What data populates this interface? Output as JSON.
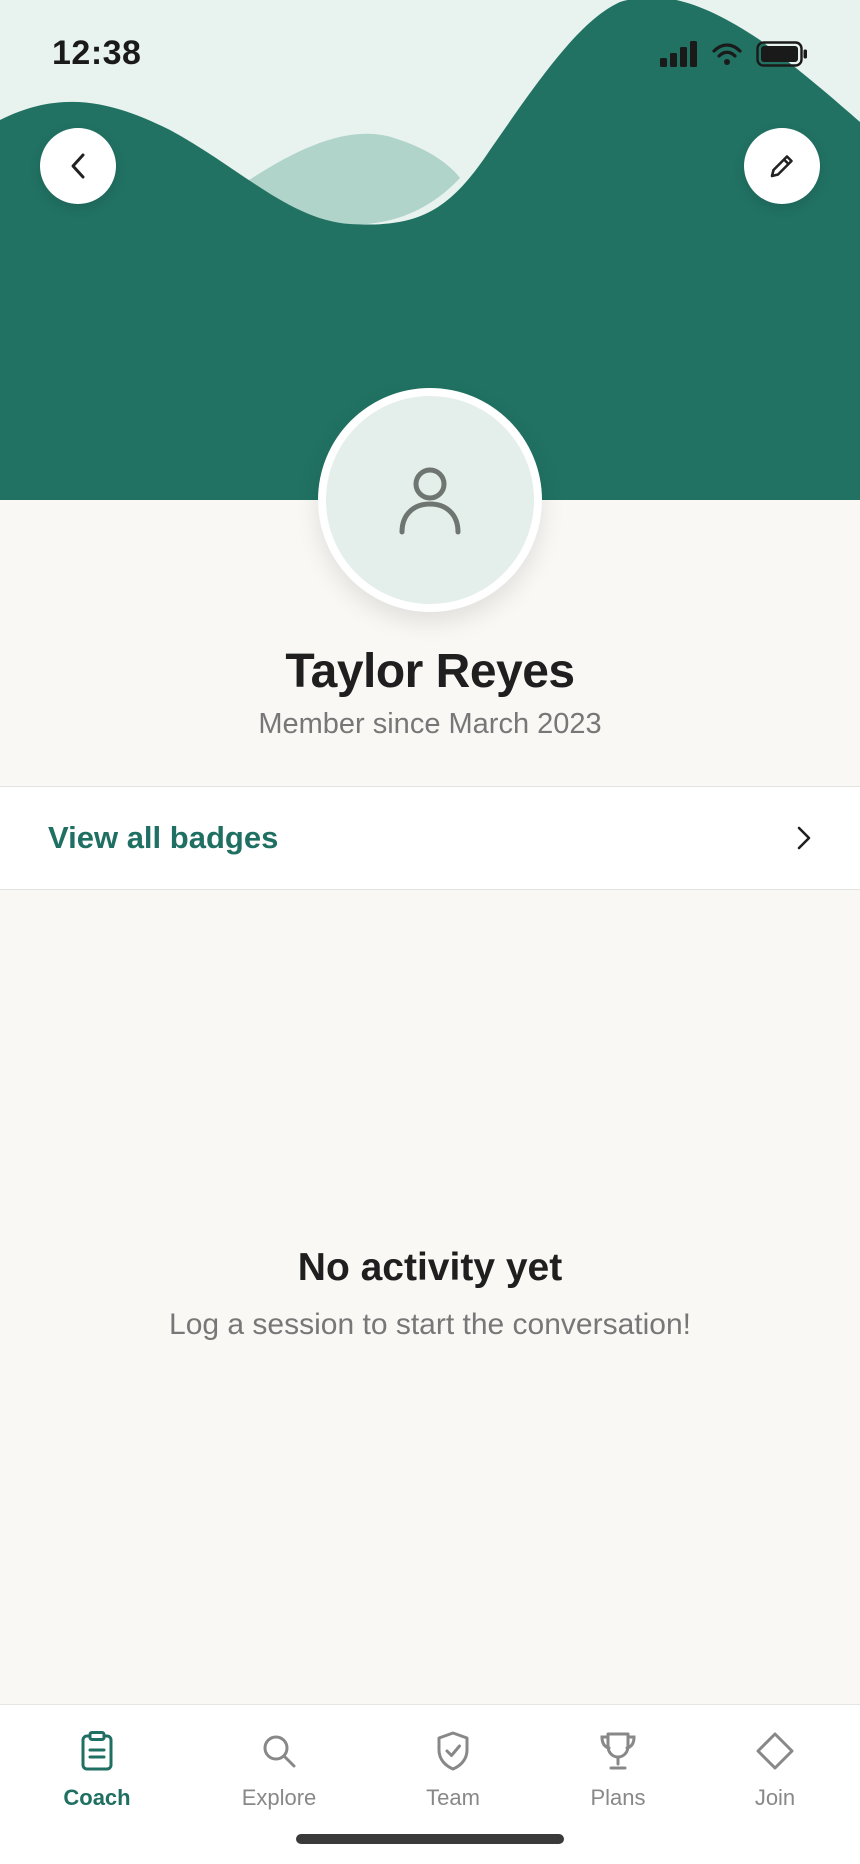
{
  "status_bar": {
    "time": "12:38"
  },
  "header": {
    "back_icon": "chevron-left-icon",
    "edit_icon": "pencil-icon",
    "colors": {
      "primary": "#217263",
      "light_bg": "#e8f2ee",
      "wave_light": "#b0d3ca"
    }
  },
  "profile": {
    "name": "Taylor Reyes",
    "member_since": "Member since March 2023",
    "avatar_icon": "user-icon"
  },
  "badges": {
    "label": "View all badges",
    "icon": "chevron-right-icon"
  },
  "empty_state": {
    "title": "No activity yet",
    "subtitle": "Log a session to start the conversation!"
  },
  "tabbar": {
    "items": [
      {
        "label": "Coach",
        "icon": "clipboard-icon",
        "active": true
      },
      {
        "label": "Explore",
        "icon": "search-icon",
        "active": false
      },
      {
        "label": "Team",
        "icon": "shield-check-icon",
        "active": false
      },
      {
        "label": "Plans",
        "icon": "trophy-icon",
        "active": false
      },
      {
        "label": "Join",
        "icon": "diamond-icon",
        "active": false
      }
    ]
  }
}
